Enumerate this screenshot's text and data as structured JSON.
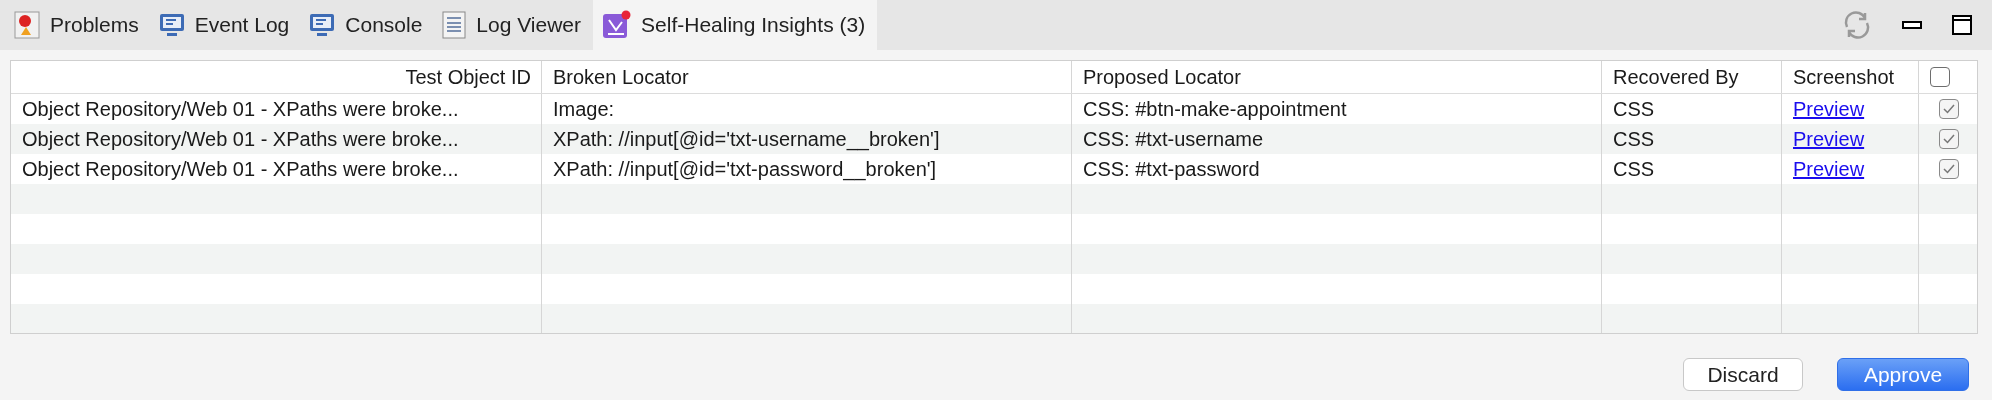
{
  "tabs": [
    {
      "label": "Problems",
      "kind": "problems",
      "selected": false
    },
    {
      "label": "Event Log",
      "kind": "monitor",
      "selected": false
    },
    {
      "label": "Console",
      "kind": "monitor",
      "selected": false
    },
    {
      "label": "Log Viewer",
      "kind": "log",
      "selected": false
    },
    {
      "label": "Self-Healing Insights (3)",
      "kind": "healing",
      "selected": true
    }
  ],
  "table": {
    "columns": [
      "Test Object ID",
      "Broken Locator",
      "Proposed Locator",
      "Recovered By",
      "Screenshot"
    ],
    "select_all": {
      "checked": false
    },
    "rows": [
      {
        "test_object_id": "Object Repository/Web 01 - XPaths were broke...",
        "broken_locator": "Image:",
        "proposed_locator": "CSS: #btn-make-appointment",
        "recovered_by": "CSS",
        "screenshot": "Preview",
        "checked": true
      },
      {
        "test_object_id": "Object Repository/Web 01 - XPaths were broke...",
        "broken_locator": "XPath: //input[@id='txt-username__broken']",
        "proposed_locator": "CSS: #txt-username",
        "recovered_by": "CSS",
        "screenshot": "Preview",
        "checked": true
      },
      {
        "test_object_id": "Object Repository/Web 01 - XPaths were broke...",
        "broken_locator": "XPath: //input[@id='txt-password__broken']",
        "proposed_locator": "CSS: #txt-password",
        "recovered_by": "CSS",
        "screenshot": "Preview",
        "checked": true
      }
    ]
  },
  "buttons": [
    {
      "label": "Discard",
      "kind": "secondary"
    },
    {
      "label": "Approve",
      "kind": "primary"
    }
  ]
}
